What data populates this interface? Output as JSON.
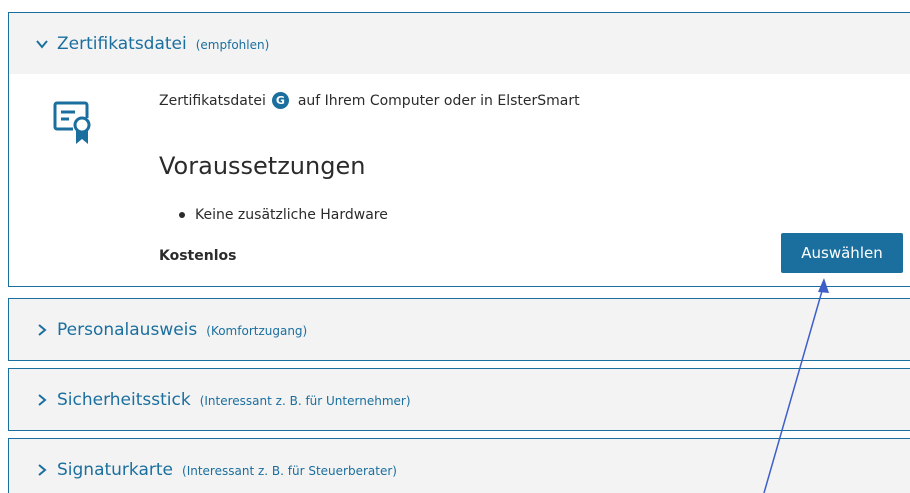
{
  "panels": [
    {
      "title": "Zertifikatsdatei",
      "subtitle": "(empfohlen)",
      "expanded": true
    },
    {
      "title": "Personalausweis",
      "subtitle": "(Komfortzugang)",
      "expanded": false
    },
    {
      "title": "Sicherheitsstick",
      "subtitle": "(Interessant z. B. für Unternehmer)",
      "expanded": false
    },
    {
      "title": "Signaturkarte",
      "subtitle": "(Interessant z. B. für Steuerberater)",
      "expanded": false
    }
  ],
  "details": {
    "intro_before": "Zertifikatsdatei",
    "badge": "G",
    "intro_after": "auf Ihrem Computer oder in ElsterSmart",
    "requirements_title": "Voraussetzungen",
    "requirements": [
      "Keine zusätzliche Hardware"
    ],
    "price": "Kostenlos",
    "select_label": "Auswählen",
    "icon": "certificate-icon"
  },
  "colors": {
    "accent": "#1b6f9e",
    "panel_bg": "#f3f3f3",
    "text": "#2b2b2b",
    "annotation_arrow": "#3f5fc8"
  }
}
